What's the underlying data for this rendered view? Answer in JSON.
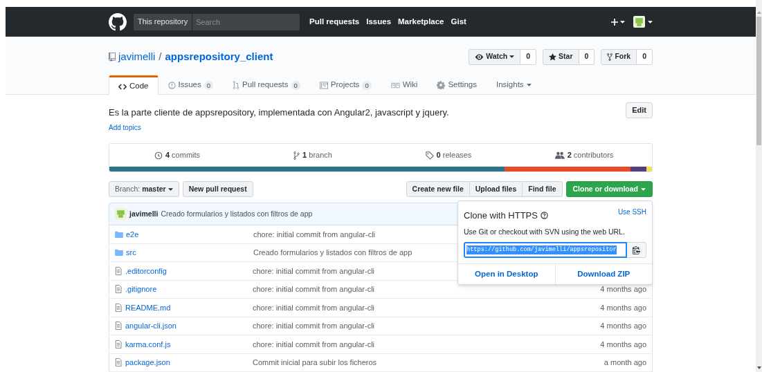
{
  "nav": {
    "scope": "This repository",
    "search_placeholder": "Search",
    "links": [
      "Pull requests",
      "Issues",
      "Marketplace",
      "Gist"
    ]
  },
  "repo": {
    "owner": "javimelli",
    "separator": "/",
    "name": "appsrepository_client",
    "actions": [
      {
        "kind": "watch",
        "label": "Watch",
        "count": "0",
        "dropdown": true
      },
      {
        "kind": "star",
        "label": "Star",
        "count": "0",
        "dropdown": false
      },
      {
        "kind": "fork",
        "label": "Fork",
        "count": "0",
        "dropdown": false
      }
    ]
  },
  "tabs": [
    {
      "kind": "code",
      "label": "Code",
      "selected": true
    },
    {
      "kind": "issues",
      "label": "Issues",
      "counter": "0",
      "selected": false
    },
    {
      "kind": "pulls",
      "label": "Pull requests",
      "counter": "0",
      "selected": false
    },
    {
      "kind": "projects",
      "label": "Projects",
      "counter": "0",
      "selected": false
    },
    {
      "kind": "wiki",
      "label": "Wiki",
      "selected": false
    },
    {
      "kind": "settings",
      "label": "Settings",
      "selected": false
    },
    {
      "kind": "insights",
      "label": "Insights",
      "dropdown": true,
      "selected": false
    }
  ],
  "description": "Es la parte cliente de appsrepository, implementada con Angular2, javascript y jquery.",
  "add_topics": "Add topics",
  "edit_button": "Edit",
  "summary": [
    {
      "kind": "commits",
      "count": "4",
      "label": "commits"
    },
    {
      "kind": "branch",
      "count": "1",
      "label": "branch"
    },
    {
      "kind": "releases",
      "count": "0",
      "label": "releases"
    },
    {
      "kind": "contributors",
      "count": "2",
      "label": "contributors"
    }
  ],
  "languages": [
    {
      "color": "#2b7489"
    },
    {
      "color": "#e34c26"
    },
    {
      "color": "#563d7c"
    },
    {
      "color": "#f1e05a"
    }
  ],
  "branch": {
    "prefix": "Branch:",
    "name": "master"
  },
  "new_pull_request": "New pull request",
  "file_actions": [
    "Create new file",
    "Upload files",
    "Find file"
  ],
  "clone_button": "Clone or download",
  "latest_commit": {
    "author": "javimelli",
    "message": "Creado formularios y listados con filtros de app"
  },
  "files": [
    {
      "kind": "dir",
      "name": "e2e",
      "message": "chore: initial commit from angular-cli"
    },
    {
      "kind": "dir",
      "name": "src",
      "message": "Creado formularios y listados con filtros de app"
    },
    {
      "kind": "file",
      "name": ".editorconfig",
      "message": "chore: initial commit from angular-cli"
    },
    {
      "kind": "file",
      "name": ".gitignore",
      "message": "chore: initial commit from angular-cli",
      "age": "4 months ago"
    },
    {
      "kind": "file",
      "name": "README.md",
      "message": "chore: initial commit from angular-cli",
      "age": "4 months ago"
    },
    {
      "kind": "file",
      "name": "angular-cli.json",
      "message": "chore: initial commit from angular-cli",
      "age": "4 months ago"
    },
    {
      "kind": "file",
      "name": "karma.conf.js",
      "message": "chore: initial commit from angular-cli",
      "age": "4 months ago"
    },
    {
      "kind": "file",
      "name": "package.json",
      "message": "Commit inicial para subir los ficheros",
      "age": "a month ago"
    }
  ],
  "clone_popup": {
    "title": "Clone with HTTPS",
    "use_ssh": "Use SSH",
    "hint": "Use Git or checkout with SVN using the web URL.",
    "url": "https://github.com/javimelli/appsrepositor",
    "actions": [
      "Open in Desktop",
      "Download ZIP"
    ]
  }
}
